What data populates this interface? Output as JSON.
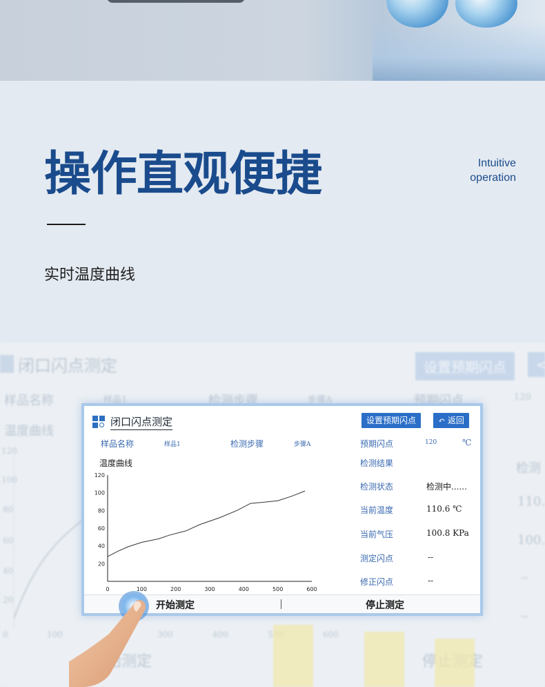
{
  "headline": "操作直观便捷",
  "english_tag": [
    "Intuitive",
    "operation"
  ],
  "subtitle": "实时温度曲线",
  "background_ui": {
    "title": "闭口闪点测定",
    "set_button": "设置预期闪点",
    "back_button": "<",
    "sample_label": "样品名称",
    "sample_value": "样品1",
    "step_label": "检测步骤",
    "step_value": "步骤A",
    "expected_label": "预期闪点",
    "expected_value": "120",
    "curve_label": "温度曲线",
    "right_label": "检测",
    "right_value_1": "110.",
    "right_value_2": "100.",
    "right_value_3": "--",
    "right_value_4": "--",
    "y_ticks": [
      "120",
      "100",
      "80",
      "60",
      "40",
      "20"
    ],
    "x_ticks": [
      "0",
      "100",
      "300",
      "400",
      "500",
      "600"
    ],
    "start_button": "开始测定",
    "stop_button": "停止测定"
  },
  "screen": {
    "title": "闭口闪点测定",
    "set_expected_button": "设置预期闪点",
    "back_button": "返回",
    "sample_name_label": "样品名称",
    "sample_name_value": "样品1",
    "detect_step_label": "检测步骤",
    "detect_step_value": "步骤A",
    "expected_flash_label": "预期闪点",
    "expected_flash_value": "120",
    "expected_flash_unit": "℃",
    "curve_label": "温度曲线",
    "result_label": "检测结果",
    "status_label": "检测状态",
    "status_value": "检测中......",
    "temp_label": "当前温度",
    "temp_value": "110.6 ℃",
    "pressure_label": "当前气压",
    "pressure_value": "100.8 KPa",
    "measured_flash_label": "测定闪点",
    "measured_flash_value": "--",
    "corrected_flash_label": "修正闪点",
    "corrected_flash_value": "--",
    "start_button": "开始测定",
    "stop_button": "停止测定"
  },
  "chart_data": {
    "type": "line",
    "title": "温度曲线",
    "xlabel": "",
    "ylabel": "",
    "xlim": [
      0,
      600
    ],
    "ylim": [
      0,
      120
    ],
    "x_ticks": [
      "0",
      "100",
      "200",
      "300",
      "400",
      "500",
      "600"
    ],
    "y_ticks": [
      "20",
      "40",
      "60",
      "80",
      "100",
      "120"
    ],
    "series": [
      {
        "x": [
          0,
          30,
          60,
          100,
          150,
          180,
          230,
          270,
          330,
          380,
          420,
          450,
          500,
          540,
          580
        ],
        "y": [
          28,
          34,
          39,
          44,
          48,
          52,
          57,
          64,
          72,
          80,
          88,
          89,
          91,
          96,
          102
        ]
      }
    ]
  }
}
